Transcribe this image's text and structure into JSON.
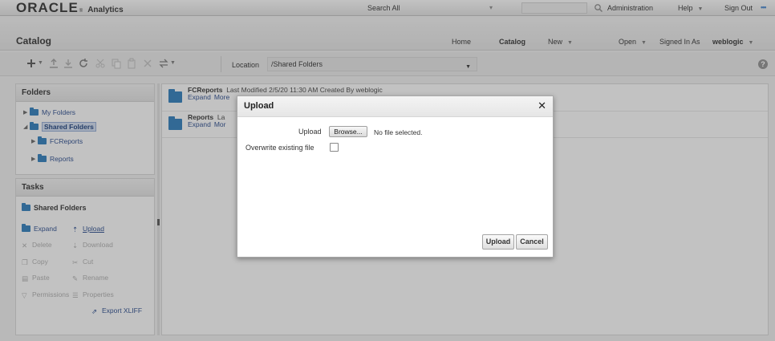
{
  "header": {
    "logo_text": "ORACLE",
    "logo_reg": "®",
    "product": "Analytics",
    "search_label": "Search",
    "search_scope": "All",
    "links": {
      "administration": "Administration",
      "help": "Help",
      "sign_out": "Sign Out"
    }
  },
  "nav": {
    "page_title": "Catalog",
    "home": "Home",
    "catalog": "Catalog",
    "new": "New",
    "open": "Open",
    "signed_in_as": "Signed In As",
    "username": "weblogic"
  },
  "toolbar": {
    "location_label": "Location",
    "location_value": "/Shared Folders",
    "help_glyph": "?"
  },
  "folders_pane": {
    "title": "Folders",
    "items": [
      {
        "label": "My Folders"
      },
      {
        "label": "Shared Folders"
      },
      {
        "label": "FCReports"
      },
      {
        "label": "Reports"
      }
    ]
  },
  "tasks_pane": {
    "title": "Tasks",
    "context": "Shared Folders",
    "tasks": {
      "expand": "Expand",
      "upload": "Upload",
      "delete": "Delete",
      "download": "Download",
      "copy": "Copy",
      "cut": "Cut",
      "paste": "Paste",
      "rename": "Rename",
      "permissions": "Permissions",
      "properties": "Properties",
      "export_xliff": "Export XLIFF"
    }
  },
  "content": {
    "items": [
      {
        "name": "FCReports",
        "meta": "Last Modified 2/5/20 11:30 AM   Created By weblogic",
        "expand": "Expand",
        "more": "More"
      },
      {
        "name": "Reports",
        "meta": "La",
        "expand": "Expand",
        "more": "Mor"
      }
    ]
  },
  "dialog": {
    "title": "Upload",
    "upload_label": "Upload",
    "browse_label": "Browse...",
    "no_file": "No file selected.",
    "overwrite_label": "Overwrite existing file",
    "overwrite_checked": false,
    "upload_button": "Upload",
    "cancel_button": "Cancel"
  },
  "colors": {
    "folder_blue": "#2f7ab8",
    "link_blue": "#2a4a8a",
    "accent_dots": "#4a86c8"
  }
}
